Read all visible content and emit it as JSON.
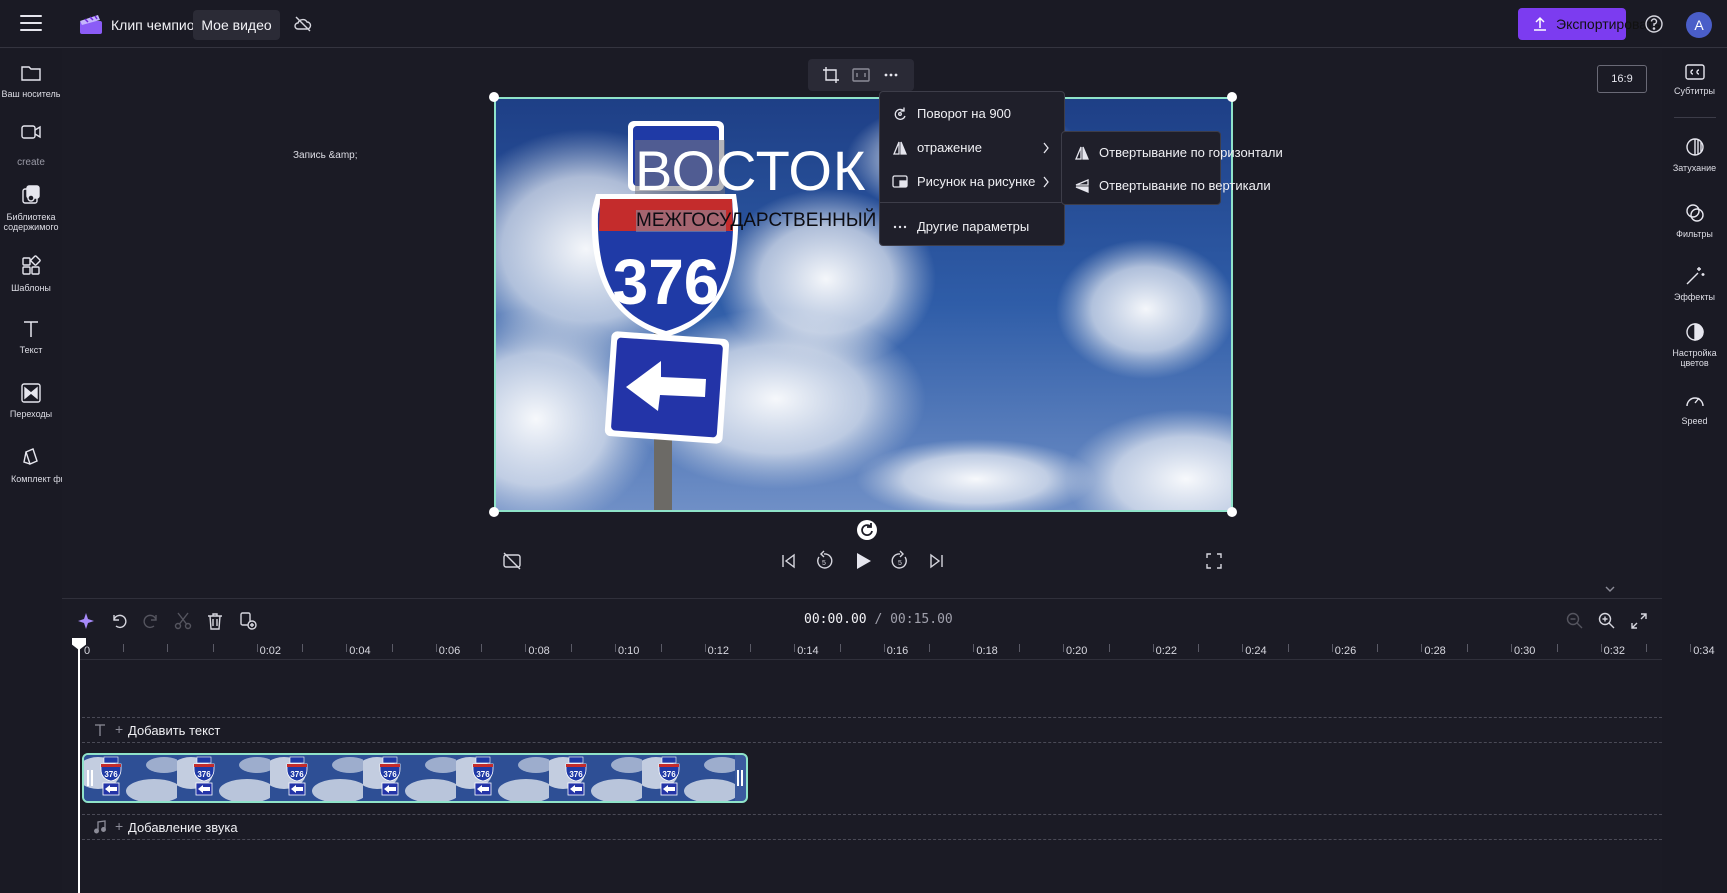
{
  "header": {
    "project_title": "Клип чемпиона",
    "my_video_tab": "Мое видео",
    "export_label": "Экспортировать",
    "avatar_initial": "A"
  },
  "left_sidebar": {
    "items": [
      {
        "label": "Ваш носитель",
        "icon": "folder-icon"
      },
      {
        "label": "",
        "icon": "video-camera-icon"
      },
      {
        "label": "Библиотека содержимого",
        "icon": "content-library-icon"
      },
      {
        "label": "Шаблоны",
        "icon": "templates-icon"
      },
      {
        "label": "Текст",
        "icon": "text-icon"
      },
      {
        "label": "Переходы",
        "icon": "transitions-icon"
      },
      {
        "label": "Комплект фирменной символики",
        "icon": "brand-kit-icon"
      }
    ],
    "create_label": "create",
    "library_line1": "Библиотека",
    "library_line2": "содержимого"
  },
  "right_sidebar": {
    "items": [
      {
        "label": "Субтитры",
        "icon": "captions-icon"
      },
      {
        "label": "Затухание",
        "icon": "fade-icon"
      },
      {
        "label": "Фильтры",
        "icon": "filters-icon"
      },
      {
        "label": "Эффекты",
        "icon": "effects-icon"
      },
      {
        "label": "Настройка цветов",
        "icon": "color-adjust-icon"
      },
      {
        "label": "Speed",
        "icon": "speed-icon"
      }
    ],
    "color_line1": "Настройка",
    "color_line2": "цветов"
  },
  "stage": {
    "record_label": "Запись &amp;",
    "aspect_ratio": "16:9",
    "overlay_title": "ВОСТОК",
    "overlay_subtitle": "МЕЖГОСУДАРСТВЕННЫЙ"
  },
  "context_menu": {
    "items": [
      {
        "label": "Поворот на 900",
        "icon": "rotate-icon",
        "has_submenu": false
      },
      {
        "label": "отражение",
        "icon": "flip-icon",
        "has_submenu": true
      },
      {
        "label": "Рисунок на рисунке",
        "icon": "picture-in-picture-icon",
        "has_submenu": true
      },
      {
        "label": "Другие параметры",
        "icon": "more-options-icon",
        "has_submenu": false
      }
    ]
  },
  "flip_submenu": {
    "items": [
      {
        "label": "Отвертывание по горизонтали",
        "icon": "flip-horizontal-icon"
      },
      {
        "label": "Отвертывание по вертикали",
        "icon": "flip-vertical-icon"
      }
    ]
  },
  "timeline": {
    "current_time": "00:00.00",
    "separator": " / ",
    "total_time": "00:15.00",
    "ruler_labels": [
      "0",
      "0:02",
      "0:04",
      "0:06",
      "0:08",
      "0:10",
      "0:12",
      "0:14",
      "0:16",
      "0:18",
      "0:20",
      "0:22",
      "0:24",
      "0:26",
      "0:28",
      "0:30",
      "0:32",
      "0:34"
    ],
    "add_text_label": "Добавить текст",
    "add_audio_label": "Добавление звука",
    "thumbnail_count": 7
  },
  "colors": {
    "accent": "#7c3cf0",
    "selection": "#8fe3c9",
    "background": "#1b1b25"
  }
}
